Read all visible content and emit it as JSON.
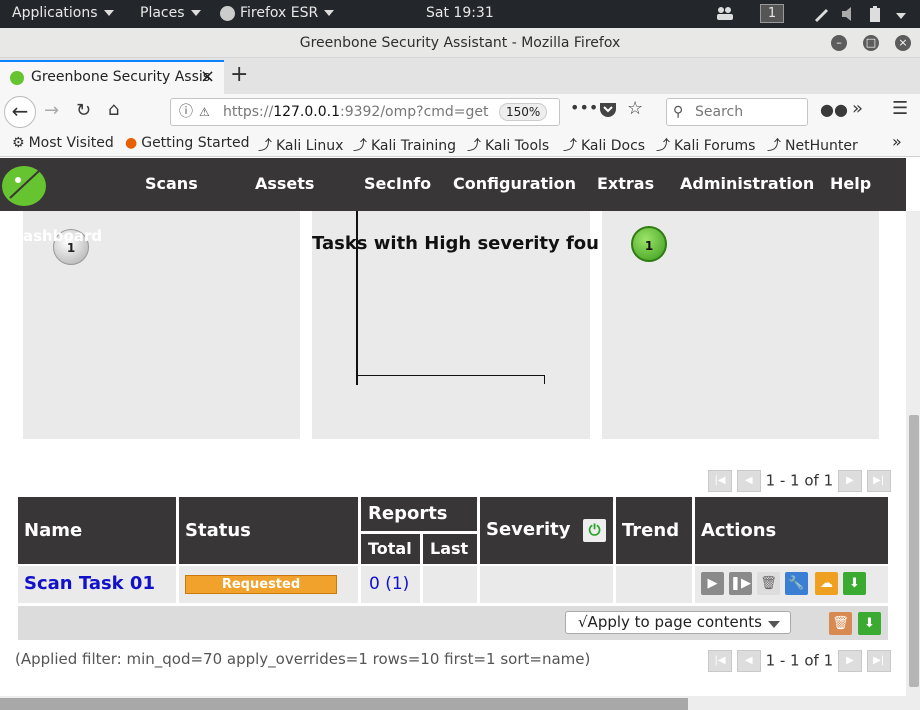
{
  "system": {
    "applications": "Applications",
    "places": "Places",
    "firefox": "Firefox ESR",
    "clock": "Sat 19:31",
    "workspace": "1"
  },
  "window": {
    "title": "Greenbone Security Assistant - Mozilla Firefox"
  },
  "tab": {
    "label": "Greenbone Security Assis",
    "close": "×",
    "new": "+"
  },
  "nav": {
    "url_prefix": "https://",
    "url_host": "127.0.0.1",
    "url_rest": ":9392/omp?cmd=get",
    "zoom": "150%",
    "search_placeholder": "Search"
  },
  "bookmarks": [
    "Most Visited",
    "Getting Started",
    "Kali Linux",
    "Kali Training",
    "Kali Tools",
    "Kali Docs",
    "Kali Forums",
    "NetHunter"
  ],
  "menu": [
    "Scans",
    "Assets",
    "SecInfo",
    "Configuration",
    "Extras",
    "Administration",
    "Help"
  ],
  "dashboard": {
    "title_fragment": "ashboard",
    "left_counter": "1",
    "chart_title": "Tasks with High severity fou",
    "right_counter": "1"
  },
  "pager_top": "1 - 1 of 1",
  "pager_bottom": "1 - 1 of 1",
  "table": {
    "headers": {
      "name": "Name",
      "status": "Status",
      "reports": "Reports",
      "total": "Total",
      "last": "Last",
      "severity": "Severity",
      "trend": "Trend",
      "actions": "Actions"
    },
    "row": {
      "name": "Scan Task 01",
      "status": "Requested",
      "total": "0",
      "total_paren": "(1)"
    }
  },
  "apply_select": "√Apply to page contents",
  "filter_text": "(Applied filter: min_qod=70 apply_overrides=1 rows=10 first=1 sort=name)",
  "colors": {
    "menu_bg": "#393637",
    "panel_bg": "#eaeaea",
    "status_bar": "#f0a22c",
    "link": "#1111cc",
    "tab_accent": "#0a84ff"
  }
}
